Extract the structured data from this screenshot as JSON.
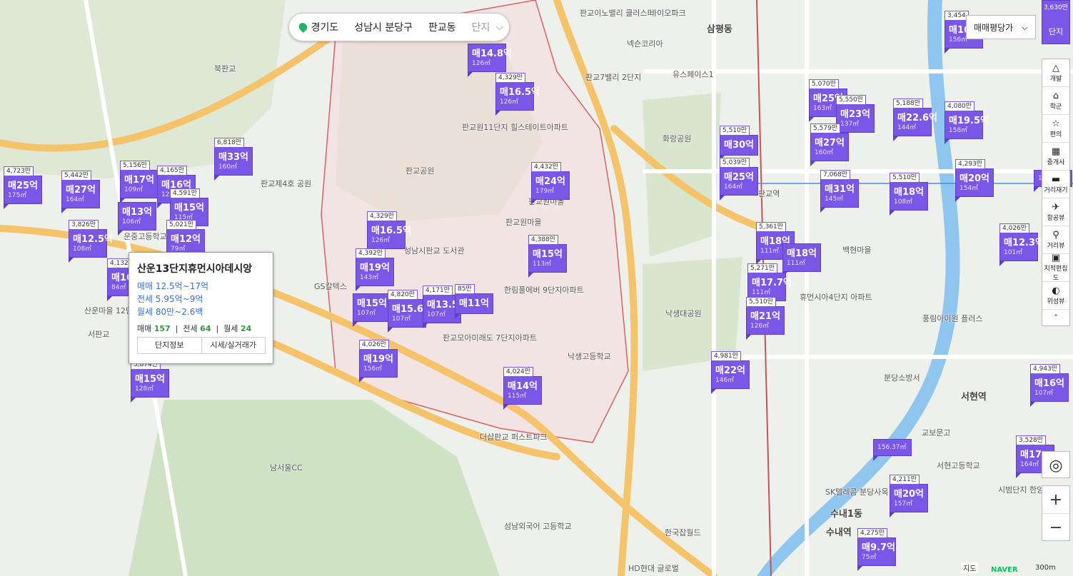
{
  "breadcrumb": {
    "province": "경기도",
    "city": "성남시 분당구",
    "dong": "판교동",
    "type": "단지"
  },
  "price_selector": {
    "value": "매매평당가"
  },
  "controls": {
    "top_toggle": "단지",
    "top_count": "3,630만",
    "tools": [
      {
        "label": "개발",
        "icon": "development-icon"
      },
      {
        "label": "학군",
        "icon": "school-icon"
      },
      {
        "label": "편의",
        "icon": "convenience-icon"
      },
      {
        "label": "중개사",
        "icon": "agent-icon"
      },
      {
        "label": "거리재기",
        "icon": "ruler-icon"
      },
      {
        "label": "항공뷰",
        "icon": "aerial-icon"
      },
      {
        "label": "거리뷰",
        "icon": "street-view-icon"
      },
      {
        "label": "지적편집도",
        "icon": "cadastral-icon"
      },
      {
        "label": "위성뷰",
        "icon": "satellite-icon"
      }
    ],
    "zoom_in": "+",
    "zoom_out": "−",
    "location": "◎"
  },
  "popup": {
    "title": "산운13단지휴먼시아데시앙",
    "sale": "매매 12.5억~17억",
    "jeonse": "전세 5.95억~9억",
    "monthly": "월세 80만~2.6백",
    "count_sale_label": "매매",
    "count_sale": "157",
    "count_jeonse_label": "전세",
    "count_jeonse": "64",
    "count_monthly_label": "월세",
    "count_monthly": "24",
    "btn_info": "단지정보",
    "btn_price": "시세/실거래가"
  },
  "markers": [
    {
      "pp": "4,723만",
      "price": "매25억",
      "area": "175㎡"
    },
    {
      "pp": "5,442만",
      "price": "매27억",
      "area": "164㎡"
    },
    {
      "pp": "5,156만",
      "price": "매17억",
      "area": "109㎡"
    },
    {
      "pp": "4,165만",
      "price": "매16억",
      "area": "121㎡"
    },
    {
      "pp": "6,818만",
      "price": "매33억",
      "area": "160㎡"
    },
    {
      "pp": "",
      "price": "매13억",
      "area": "106㎡"
    },
    {
      "pp": "4,591만",
      "price": "매15억",
      "area": "115㎡"
    },
    {
      "pp": "3,826만",
      "price": "매12.5억",
      "area": "108㎡"
    },
    {
      "pp": "5,021만",
      "price": "매12억",
      "area": "79㎡"
    },
    {
      "pp": "4,132",
      "price": "매16",
      "area": "84㎡"
    },
    {
      "pp": "3,874만",
      "price": "매15억",
      "area": "128㎡"
    },
    {
      "pp": "",
      "price": "매14.8억",
      "area": "126㎡"
    },
    {
      "pp": "4,329만",
      "price": "매16.5억",
      "area": "126㎡"
    },
    {
      "pp": "4,432만",
      "price": "매24억",
      "area": "179㎡"
    },
    {
      "pp": "4,329만",
      "price": "매16.5억",
      "area": "126㎡"
    },
    {
      "pp": "4,392만",
      "price": "매19억",
      "area": "143㎡"
    },
    {
      "pp": "4,388만",
      "price": "매15억",
      "area": "113㎡"
    },
    {
      "pp": "",
      "price": "매15억",
      "area": "107㎡"
    },
    {
      "pp": "4,820만",
      "price": "매15.6억",
      "area": "107㎡"
    },
    {
      "pp": "4,171만",
      "price": "매13.5억",
      "area": "107㎡"
    },
    {
      "pp": "85만",
      "price": "매11억",
      "area": ""
    },
    {
      "pp": "4,026만",
      "price": "매19억",
      "area": "156㎡"
    },
    {
      "pp": "4,024만",
      "price": "매14억",
      "area": "115㎡"
    },
    {
      "pp": "5,510만",
      "price": "매30억",
      "area": ""
    },
    {
      "pp": "5,039만",
      "price": "매25억",
      "area": "164㎡"
    },
    {
      "pp": "5,070만",
      "price": "매25억",
      "area": "163㎡"
    },
    {
      "pp": "5,550만",
      "price": "매23억",
      "area": "137㎡"
    },
    {
      "pp": "5,579만",
      "price": "매27억",
      "area": "160㎡"
    },
    {
      "pp": "7,068만",
      "price": "매31억",
      "area": "145㎡"
    },
    {
      "pp": "5,188만",
      "price": "매22.6억",
      "area": "144㎡"
    },
    {
      "pp": "4,080만",
      "price": "매19.5억",
      "area": "158㎡"
    },
    {
      "pp": "5,510만",
      "price": "매18억",
      "area": "108㎡"
    },
    {
      "pp": "4,293만",
      "price": "매20억",
      "area": "154㎡"
    },
    {
      "pp": "5,361만",
      "price": "매18억",
      "area": "111㎡"
    },
    {
      "pp": "",
      "price": "매18억",
      "area": "111㎡"
    },
    {
      "pp": "5,271만",
      "price": "매17.7억",
      "area": "111㎡"
    },
    {
      "pp": "5,510만",
      "price": "매21억",
      "area": "126㎡"
    },
    {
      "pp": "4,981만",
      "price": "매22억",
      "area": "146㎡"
    },
    {
      "pp": "4,026만",
      "price": "매12.3억",
      "area": "101㎡"
    },
    {
      "pp": "4,943만",
      "price": "매16억",
      "area": "107㎡"
    },
    {
      "pp": "3,454",
      "price": "매16",
      "area": "156㎡"
    },
    {
      "pp": "3,528만",
      "price": "매17",
      "area": "164㎡"
    },
    {
      "pp": "4,211만",
      "price": "매20억",
      "area": "157㎡"
    },
    {
      "pp": "4,275만",
      "price": "매9.7억",
      "area": "75㎡"
    },
    {
      "pp": "",
      "price": "",
      "area": "156.37㎡"
    },
    {
      "pp": "",
      "price": "",
      "area": "154㎡"
    }
  ],
  "places": [
    "판교이노밸리 클러스터",
    "삼평동",
    "바이오파크",
    "넥슨코리아",
    "유스페이스1",
    "판교7밸리 2단지",
    "판교원11단지 힐스테이트아파트",
    "판교공원",
    "판교제4호 공원",
    "판교원마을",
    "한림풀에버 9단지아파트",
    "판교모아미래도 7단지아파트",
    "성남시판교 도서관",
    "더샵판교 퍼스트파크",
    "남서울CC",
    "성남외국어 고등학교",
    "낙생고등학교",
    "낙생대공원",
    "화랑공원",
    "판교역",
    "백현마을",
    "휴먼시아4단지 아파트",
    "풍림아이원 플러스",
    "서현역",
    "분당소방서",
    "교보문고",
    "SK텔레콤 분당사옥",
    "수내1동",
    "수내역",
    "한국잡월드",
    "HD현대 글로벌",
    "운중고등학교",
    "GS칼텍스",
    "산운마을 12단지아파트",
    "서판교",
    "북판교",
    "판교원마을",
    "서현고등학교",
    "시범단지 한양아파트"
  ],
  "footer": {
    "map_label": "지도",
    "naver": "NAVER",
    "scale": "300m"
  }
}
